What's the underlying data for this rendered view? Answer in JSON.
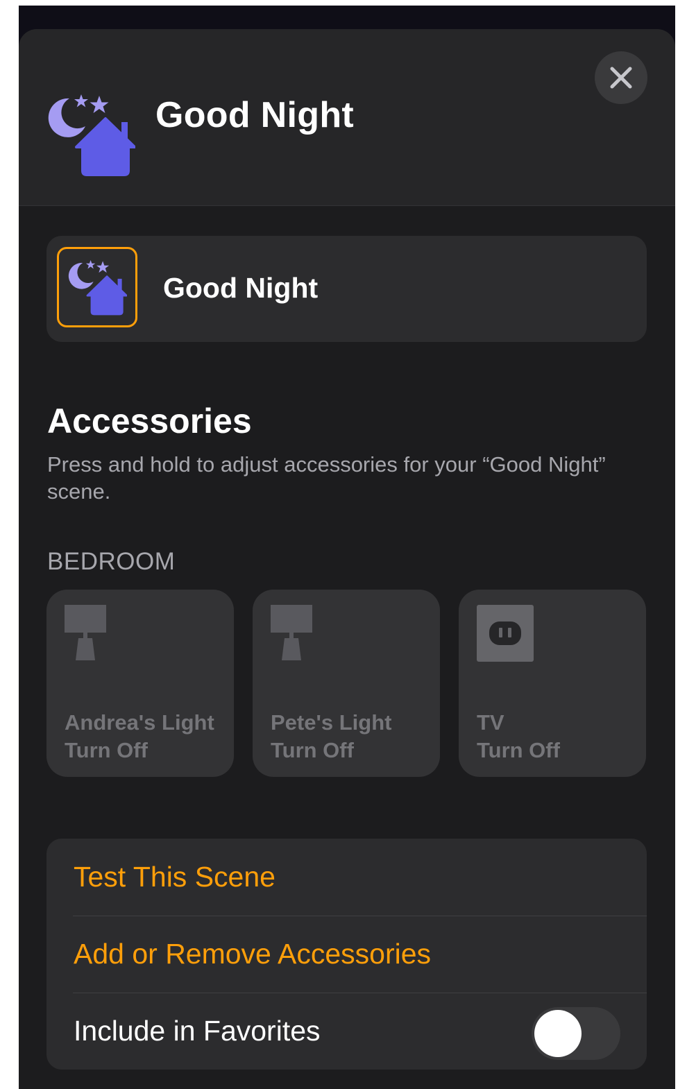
{
  "header": {
    "title": "Good Night",
    "icon": "good-night-scene-icon",
    "close_icon": "close-icon"
  },
  "scene": {
    "name": "Good Night",
    "icon": "good-night-scene-icon",
    "accent_color": "#ff9f0a"
  },
  "accessories": {
    "title": "Accessories",
    "description": "Press and hold to adjust accessories for your “Good Night” scene.",
    "room": "BEDROOM",
    "tiles": [
      {
        "name": "Andrea's Light",
        "status": "Turn Off",
        "icon": "lamp-icon"
      },
      {
        "name": "Pete's Light",
        "status": "Turn Off",
        "icon": "lamp-icon"
      },
      {
        "name": "TV",
        "status": "Turn Off",
        "icon": "outlet-icon"
      }
    ]
  },
  "actions": {
    "test": "Test This Scene",
    "add_remove": "Add or Remove Accessories",
    "favorites": "Include in Favorites",
    "favorites_enabled": false
  },
  "colors": {
    "accent": "#ff9f0a",
    "scene_purple": "#5e5ce6",
    "moon_lavender": "#a59cf2",
    "background": "#1c1c1e"
  }
}
